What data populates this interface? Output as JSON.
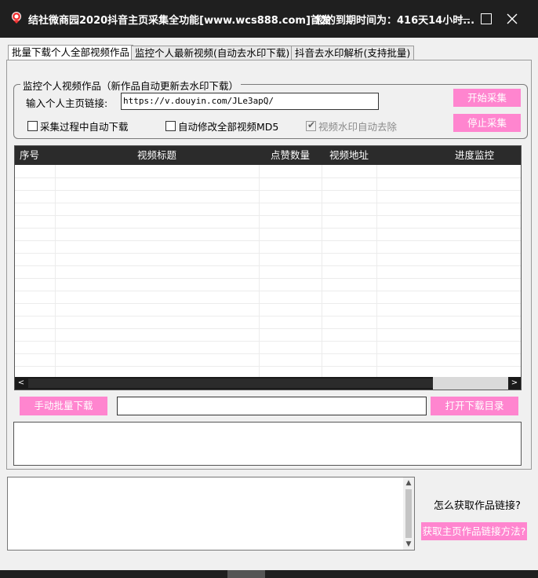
{
  "window": {
    "title": "结社微商园2020抖音主页采集全功能[www.wcs888.com]首发",
    "expire_text": "您的到期时间为：416天14小时...",
    "controls": {
      "minimize": "—",
      "maximize": "☐",
      "close": "✕"
    },
    "icon": "app-logo-icon"
  },
  "tabs": [
    {
      "label": "批量下载个人全部视频作品",
      "active": true
    },
    {
      "label": "监控个人最新视频(自动去水印下载)",
      "active": false
    },
    {
      "label": "抖音去水印解析(支持批量)",
      "active": false
    }
  ],
  "monitor_group": {
    "title": "监控个人视频作品（新作品自动更新去水印下载）",
    "url_label": "输入个人主页链接:",
    "url_value": "https://v.douyin.com/JLe3apQ/",
    "checkboxes": [
      {
        "label": "采集过程中自动下载",
        "checked": false,
        "enabled": true
      },
      {
        "label": "自动修改全部视频MD5",
        "checked": false,
        "enabled": true
      },
      {
        "label": "视频水印自动去除",
        "checked": true,
        "enabled": false
      }
    ],
    "start_button": "开始采集",
    "stop_button": "停止采集"
  },
  "table": {
    "columns": [
      "序号",
      "视频标题",
      "点赞数量",
      "视频地址",
      "进度监控"
    ],
    "rows": []
  },
  "scrollbar": {
    "left_arrow": "<",
    "right_arrow": ">",
    "up_arrow": "▲",
    "down_arrow": "▼"
  },
  "actions": {
    "manual_download": "手动批量下载",
    "progress_value": "",
    "open_folder": "打开下载目录"
  },
  "bottom": {
    "log_text": "",
    "help_question": "怎么获取作品链接?",
    "help_button": "获取主页作品链接方法?"
  },
  "colors": {
    "accent_pink": "#ff85cf",
    "titlebar": "#1f1f1f",
    "table_header": "#2b2b2b"
  }
}
